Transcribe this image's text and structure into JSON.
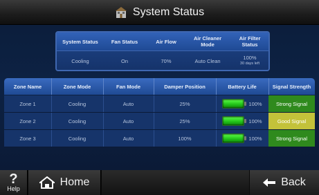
{
  "header": {
    "title": "System Status",
    "icon": "house-icon"
  },
  "system_table": {
    "headers": [
      "System Status",
      "Fan Status",
      "Air Flow",
      "Air Cleaner\nMode",
      "Air Filter\nStatus"
    ],
    "values": {
      "system_status": "Cooling",
      "fan_status": "On",
      "air_flow": "70%",
      "air_cleaner_mode": "Auto Clean",
      "air_filter_status": "100%",
      "air_filter_sub": "30 days left"
    }
  },
  "zone_table": {
    "headers": [
      "Zone Name",
      "Zone Mode",
      "Fan Mode",
      "Damper Position",
      "Battery Life",
      "Signal Strength"
    ],
    "rows": [
      {
        "name": "Zone 1",
        "mode": "Cooling",
        "fan": "Auto",
        "damper": "25%",
        "battery": "100%",
        "signal": "Strong Signal",
        "signal_color": "#2f8a1d"
      },
      {
        "name": "Zone 2",
        "mode": "Cooling",
        "fan": "Auto",
        "damper": "25%",
        "battery": "100%",
        "signal": "Good Signal",
        "signal_color": "#c3c23a"
      },
      {
        "name": "Zone 3",
        "mode": "Cooling",
        "fan": "Auto",
        "damper": "100%",
        "battery": "100%",
        "signal": "Strong Signal",
        "signal_color": "#2f8a1d"
      }
    ]
  },
  "footer": {
    "help_label": "Help",
    "home_label": "Home",
    "back_label": "Back"
  },
  "colors": {
    "accent": "#3262b8",
    "strong": "#2f8a1d",
    "good": "#c3c23a",
    "battery": "#24c51a"
  }
}
